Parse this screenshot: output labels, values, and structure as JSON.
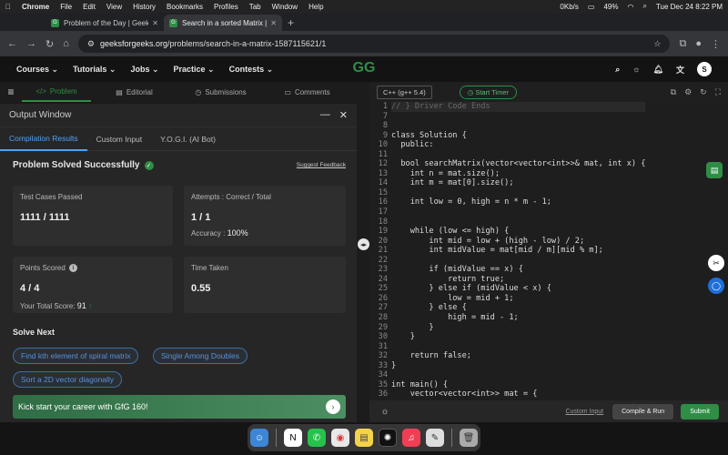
{
  "menubar": {
    "items": [
      "Chrome",
      "File",
      "Edit",
      "View",
      "History",
      "Bookmarks",
      "Profiles",
      "Tab",
      "Window",
      "Help"
    ],
    "network": "0Kb/s",
    "battery": "49%",
    "clock": "Tue Dec 24  8:22 PM"
  },
  "tabs": [
    {
      "title": "Problem of the Day | Geeksfo",
      "icon": "gfg-favicon"
    },
    {
      "title": "Search in a sorted Matrix | Pr",
      "icon": "gfg-favicon"
    }
  ],
  "address": {
    "host": "geeksforgeeks.org",
    "path": "/problems/search-in-a-matrix-1587115621/1"
  },
  "gfg_nav": {
    "items": [
      "Courses",
      "Tutorials",
      "Jobs",
      "Practice",
      "Contests"
    ],
    "logo": "GG",
    "avatar": "S"
  },
  "problem_tabs": [
    "Problem",
    "Editorial",
    "Submissions",
    "Comments"
  ],
  "output": {
    "title": "Output Window",
    "subtabs": [
      "Compilation Results",
      "Custom Input",
      "Y.O.G.I. (AI Bot)"
    ],
    "status": "Problem Solved Successfully",
    "feedback": "Suggest Feedback",
    "test_cases_label": "Test Cases Passed",
    "test_cases_value": "1111 / 1111",
    "attempts_label": "Attempts : Correct / Total",
    "attempts_value": "1 / 1",
    "accuracy_label": "Accuracy :",
    "accuracy_value": "100%",
    "points_label": "Points Scored",
    "points_value": "4 / 4",
    "total_score_label": "Your Total Score:",
    "total_score_value": "91",
    "time_label": "Time Taken",
    "time_value": "0.55",
    "solve_next": "Solve Next",
    "chips": [
      "Find kth element of spiral matrix",
      "Single Among Doubles",
      "Sort a 2D vector diagonally"
    ],
    "banner": "Kick start your career with GfG 160!"
  },
  "editor": {
    "language": "C++ (g++ 5.4)",
    "timer": "Start Timer",
    "line_numbers": [
      "1",
      "7",
      "8",
      "9",
      "10",
      "11",
      "12",
      "13",
      "14",
      "15",
      "16",
      "17",
      "18",
      "19",
      "20",
      "21",
      "22",
      "23",
      "24",
      "25",
      "26",
      "27",
      "28",
      "29",
      "30",
      "31",
      "32",
      "33",
      "34",
      "35",
      "36"
    ],
    "lines": [
      "// } Driver Code Ends",
      "",
      "",
      "class Solution {",
      "  public:",
      "",
      "  bool searchMatrix(vector<vector<int>>& mat, int x) {",
      "    int n = mat.size();",
      "    int m = mat[0].size();",
      "",
      "    int low = 0, high = n * m - 1;",
      "",
      "",
      "    while (low <= high) {",
      "        int mid = low + (high - low) / 2;",
      "        int midValue = mat[mid / m][mid % m];",
      "",
      "        if (midValue == x) {",
      "            return true;",
      "        } else if (midValue < x) {",
      "            low = mid + 1;",
      "        } else {",
      "            high = mid - 1;",
      "        }",
      "    }",
      "",
      "    return false;",
      "}",
      "",
      "int main() {",
      "    vector<vector<int>> mat = {"
    ],
    "custom_input": "Custom Input",
    "compile_run": "Compile & Run",
    "submit": "Submit"
  },
  "colors": {
    "accent": "#2f8d46",
    "link": "#4da3ff"
  }
}
